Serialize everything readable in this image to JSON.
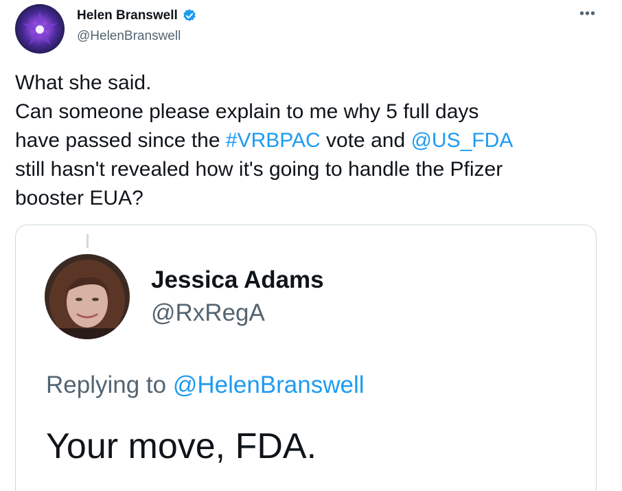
{
  "tweet": {
    "author": {
      "name": "Helen Branswell",
      "handle": "@HelenBranswell",
      "verified": true,
      "avatar_icon": "purple-flower-avatar"
    },
    "more_icon": "more-horizontal-icon",
    "text": {
      "line1": "What she said.",
      "line2": "Can someone please explain to me why 5 full days",
      "line3_a": "have passed since the ",
      "line3_hashtag": "#VRBPAC",
      "line3_b": " vote and ",
      "line3_mention": "@US_FDA",
      "line4": "still hasn't revealed how it's going to handle the Pfizer",
      "line5": "booster EUA?"
    }
  },
  "quote": {
    "author": {
      "name": "Jessica Adams",
      "handle": "@RxRegA",
      "avatar_icon": "woman-portrait-avatar"
    },
    "replying_prefix": "Replying to ",
    "replying_to": "@HelenBranswell",
    "text": "Your move, FDA."
  },
  "colors": {
    "link": "#1d9bf0",
    "secondary_text": "#536471",
    "primary_text": "#0f1419",
    "border": "#cfd9de",
    "verified_badge": "#1d9bf0"
  }
}
